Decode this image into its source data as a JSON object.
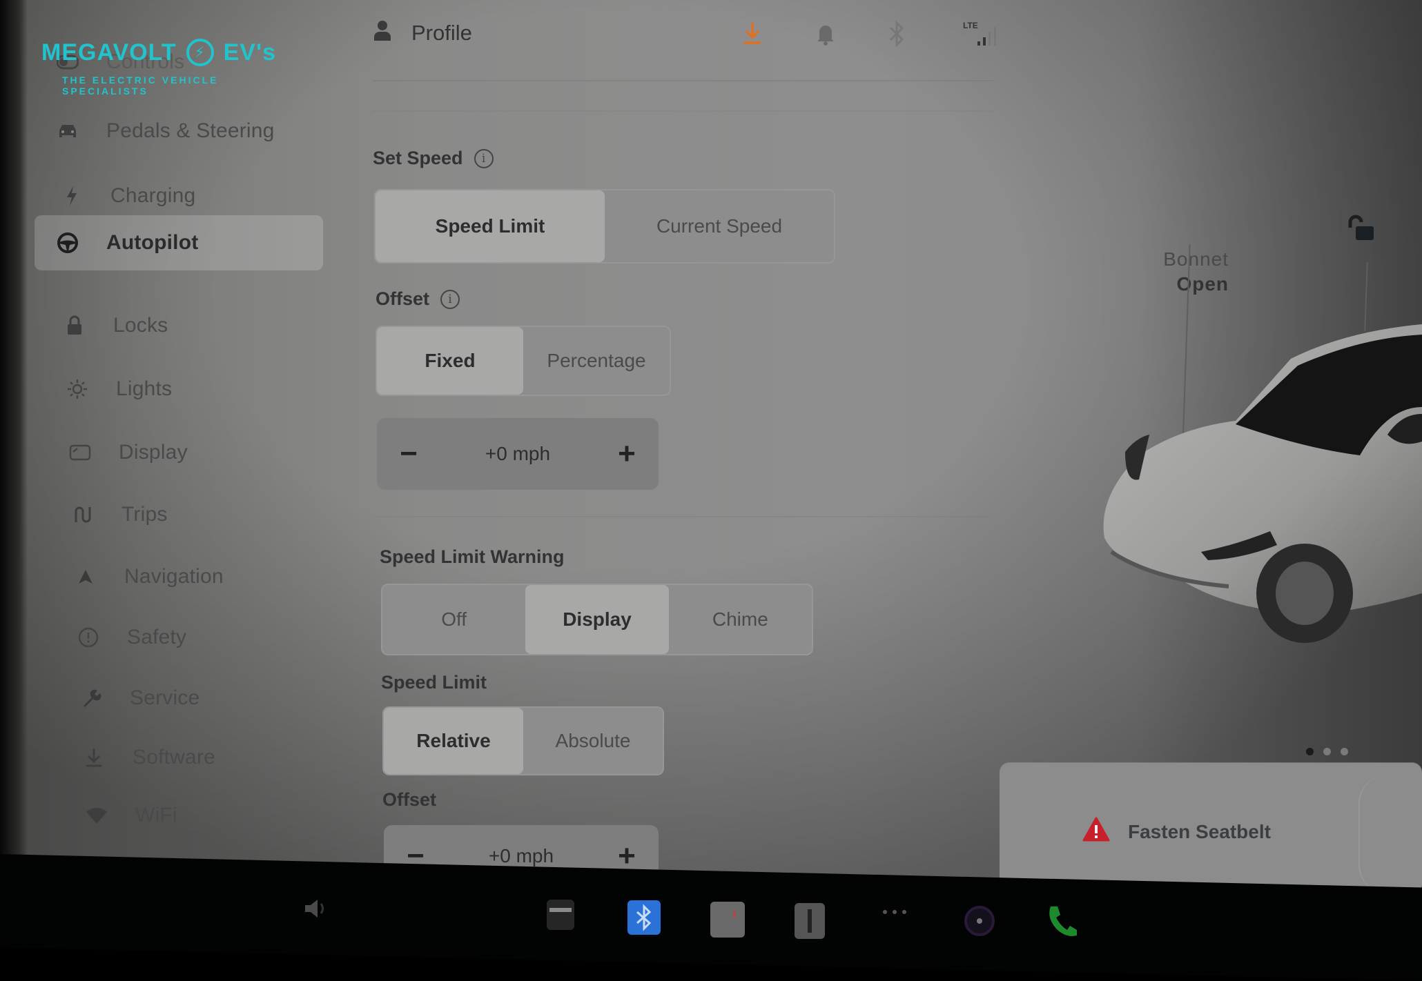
{
  "logo": {
    "brand_left": "MEGAVOLT",
    "brand_right": "EV's",
    "tagline": "THE ELECTRIC VEHICLE SPECIALISTS",
    "color": "#21c4cc"
  },
  "sidebar": {
    "items": [
      {
        "label": "Controls",
        "icon": "toggle-icon",
        "active": false
      },
      {
        "label": "Pedals & Steering",
        "icon": "car-icon",
        "active": false
      },
      {
        "label": "Charging",
        "icon": "bolt-icon",
        "active": false
      },
      {
        "label": "Autopilot",
        "icon": "steering-wheel-icon",
        "active": true
      },
      {
        "label": "Locks",
        "icon": "lock-icon",
        "active": false
      },
      {
        "label": "Lights",
        "icon": "sun-icon",
        "active": false
      },
      {
        "label": "Display",
        "icon": "display-icon",
        "active": false
      },
      {
        "label": "Trips",
        "icon": "trips-icon",
        "active": false
      },
      {
        "label": "Navigation",
        "icon": "navigation-arrow-icon",
        "active": false
      },
      {
        "label": "Safety",
        "icon": "safety-icon",
        "active": false
      },
      {
        "label": "Service",
        "icon": "wrench-icon",
        "active": false
      },
      {
        "label": "Software",
        "icon": "download-icon",
        "active": false
      },
      {
        "label": "WiFi",
        "icon": "wifi-icon",
        "active": false
      }
    ]
  },
  "header": {
    "profile_label": "Profile",
    "status": {
      "download_color": "#e07020",
      "lte_label": "LTE",
      "signal_bars": 4,
      "signal_bars_filled": 2
    }
  },
  "settings": {
    "set_speed": {
      "label": "Set Speed",
      "options": [
        "Speed Limit",
        "Current Speed"
      ],
      "selected": "Speed Limit"
    },
    "offset": {
      "label": "Offset",
      "options": [
        "Fixed",
        "Percentage"
      ],
      "selected": "Fixed",
      "value": "+0 mph",
      "minus": "−",
      "plus": "+"
    },
    "speed_limit_warning": {
      "label": "Speed Limit Warning",
      "options": [
        "Off",
        "Display",
        "Chime"
      ],
      "selected": "Display"
    },
    "speed_limit": {
      "label": "Speed Limit",
      "options": [
        "Relative",
        "Absolute"
      ],
      "selected": "Relative"
    },
    "warning_offset": {
      "label": "Offset",
      "value": "+0 mph",
      "minus": "−",
      "plus": "+"
    }
  },
  "vehicle": {
    "bonnet_label": "Bonnet",
    "bonnet_state": "Open",
    "page_dots": 3,
    "active_page": 1
  },
  "alert": {
    "text": "Fasten Seatbelt",
    "icon_color": "#c8202a"
  },
  "dock": {
    "bluetooth_color": "#2a72d8",
    "phone_color": "#1e8a2e"
  }
}
